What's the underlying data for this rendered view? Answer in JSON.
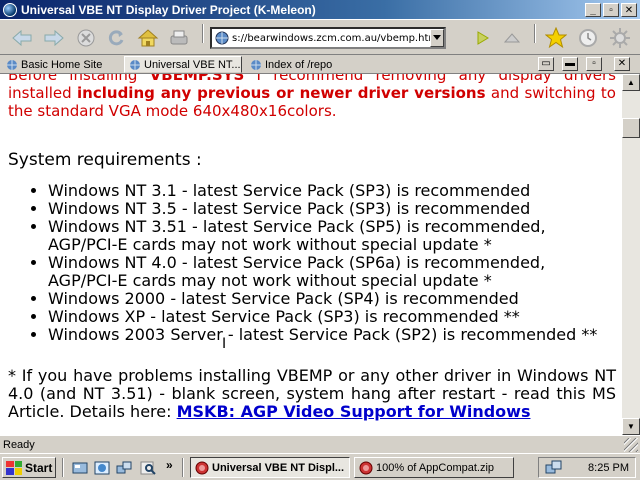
{
  "window": {
    "title": "Universal VBE NT Display Driver Project (K-Meleon)"
  },
  "address_bar": {
    "url": "s://bearwindows.zcm.com.au/vbemp.htm"
  },
  "tabs": [
    {
      "label": "Basic Home Site"
    },
    {
      "label": "Universal VBE NT..."
    },
    {
      "label": "Index of /repo"
    }
  ],
  "content": {
    "intro_part1": "Before installing ",
    "intro_bold1": "VBEMP.SYS",
    "intro_part2": " I recommend removing any display drivers installed ",
    "intro_bold2": "including any previous or newer driver versions",
    "intro_part3": " and switching to the standard VGA mode 640x480x16colors.",
    "sysreq_heading": "System requirements :",
    "requirements": [
      "Windows NT 3.1 - latest Service Pack (SP3) is recommended",
      "Windows NT 3.5 - latest Service Pack (SP3) is recommended",
      "Windows NT 3.51 - latest Service Pack (SP5) is recommended, AGP/PCI-E cards may not work without special update *",
      "Windows NT 4.0 - latest Service Pack (SP6a) is recommended, AGP/PCI-E cards may not work without special update *",
      "Windows 2000 - latest Service Pack (SP4) is recommended",
      "Windows XP - latest Service Pack (SP3) is recommended **",
      "Windows 2003 Server - latest Service Pack (SP2) is recommended **"
    ],
    "note_text": "* If you have problems installing VBEMP or any other driver in Windows NT 4.0 (and NT 3.51) - blank screen, system hang after restart - read this MS Article. Details here: ",
    "note_link": "MSKB: AGP Video Support for Windows"
  },
  "status": {
    "text": "Ready"
  },
  "taskbar": {
    "start_label": "Start",
    "tasks": [
      {
        "label": "Universal VBE NT Displ..."
      },
      {
        "label": "100% of AppCompat.zip"
      }
    ],
    "clock": "8:25 PM",
    "overflow_label": "»"
  },
  "colors": {
    "title_gradient_start": "#0a246a",
    "accent_red": "#d00000",
    "link_blue": "#0000cc"
  },
  "icons": [
    "back-icon",
    "forward-icon",
    "stop-icon",
    "reload-icon",
    "home-icon",
    "print-icon",
    "go-icon",
    "up-icon",
    "bookmark-star-icon",
    "history-icon",
    "settings-icon"
  ]
}
